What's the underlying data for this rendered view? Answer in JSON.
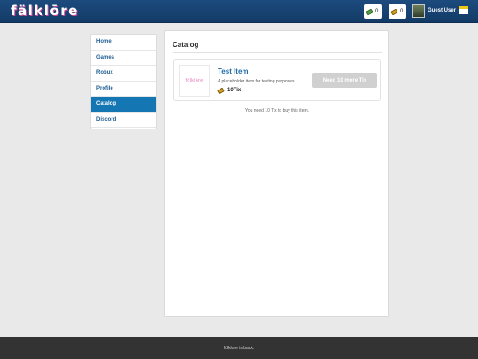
{
  "header": {
    "logo": "fälklōre",
    "robux_value": "0",
    "tix_value": "0",
    "username": "Guest User",
    "icons": [
      "robux-icon",
      "tix-icon",
      "avatar",
      "mail-icon"
    ]
  },
  "sidebar": {
    "items": [
      {
        "label": "Games"
      },
      {
        "label": "Home"
      },
      {
        "label": "Robux"
      },
      {
        "label": "Profile"
      },
      {
        "label": "Catalog"
      },
      {
        "label": "Discord"
      }
    ],
    "active": "Catalog"
  },
  "main": {
    "title": "Catalog",
    "item": {
      "thumbnail_text": "fölklōre",
      "name": "Test Item",
      "description": "A placeholder item for testing purposes.",
      "price": "10Tix",
      "button_label": "Need 10 more Tix"
    },
    "need_message": "You need 10 Tix to buy this item."
  },
  "footer": {
    "text": "fölklore is back."
  },
  "colors": {
    "header": "#1b4677",
    "accent": "#1576b4",
    "link": "#1e6aa7",
    "disabled_button": "#d0d0d0",
    "footer": "#333333"
  }
}
